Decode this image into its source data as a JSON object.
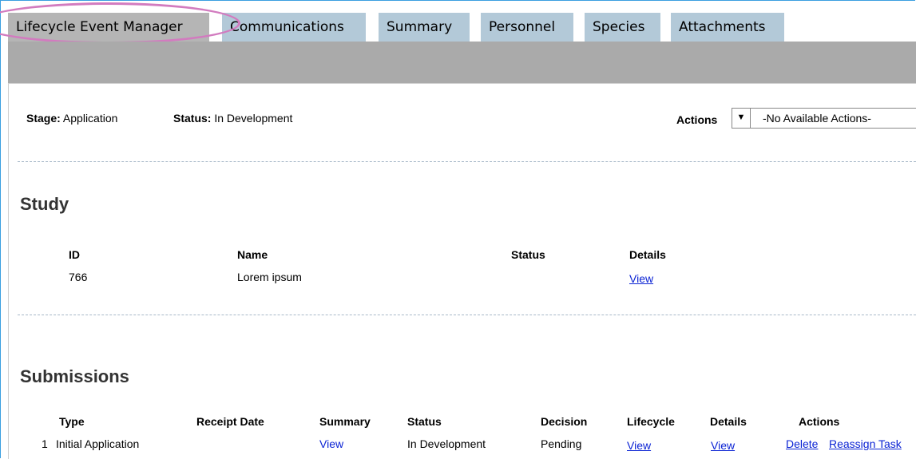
{
  "tabs": [
    {
      "label": "Lifecycle Event Manager"
    },
    {
      "label": "Communications"
    },
    {
      "label": "Summary"
    },
    {
      "label": "Personnel"
    },
    {
      "label": "Species"
    },
    {
      "label": "Attachments"
    }
  ],
  "info": {
    "stage_label": "Stage:",
    "stage_value": "Application",
    "status_label": "Status:",
    "status_value": "In Development",
    "actions_label": "Actions",
    "actions_selected": "-No Available Actions-"
  },
  "study": {
    "title": "Study",
    "headers": {
      "id": "ID",
      "name": "Name",
      "status": "Status",
      "details": "Details"
    },
    "row": {
      "id": "766",
      "name": "Lorem ipsum",
      "status": "",
      "details": "View"
    }
  },
  "submissions": {
    "title": "Submissions",
    "headers": {
      "type": "Type",
      "receipt_date": "Receipt Date",
      "summary": "Summary",
      "status": "Status",
      "decision": "Decision",
      "lifecycle": "Lifecycle",
      "details": "Details",
      "actions": "Actions"
    },
    "rows": [
      {
        "num": "1",
        "type": "Initial Application",
        "receipt_date": "",
        "summary": "View",
        "status": "In Development",
        "decision": "Pending",
        "lifecycle": "View",
        "details": "View",
        "action_delete": "Delete",
        "action_reassign": "Reassign Task"
      }
    ]
  },
  "colors": {
    "tab": "#b3c9d8",
    "tab_active": "#b5b5b5",
    "band": "#aaaaaa",
    "link": "#0b23d4",
    "highlight": "#d27bbf"
  }
}
